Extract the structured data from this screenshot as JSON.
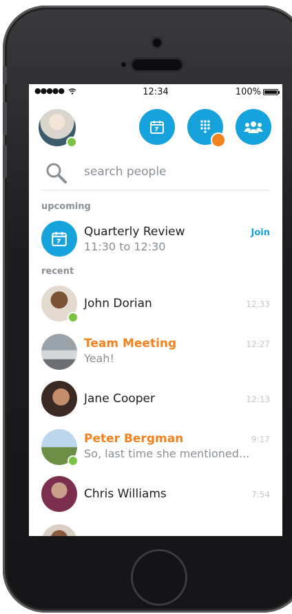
{
  "status_bar": {
    "signal": "●●●●●",
    "time": "12:34",
    "battery": "100%",
    "battery_level": 1.0
  },
  "search": {
    "placeholder": "search people"
  },
  "sections": {
    "upcoming": "upcoming",
    "recent": "recent"
  },
  "upcoming": {
    "title": "Quarterly Review",
    "time_range": "11:30 to 12:30",
    "action": "Join",
    "icon": "calendar-icon"
  },
  "recent": [
    {
      "name": "John Dorian",
      "message": "",
      "time": "12:33",
      "online": true,
      "highlight": false
    },
    {
      "name": "Team Meeting",
      "message": "Yeah!",
      "time": "12:27",
      "online": false,
      "highlight": true
    },
    {
      "name": "Jane Cooper",
      "message": "",
      "time": "12:13",
      "online": false,
      "highlight": false
    },
    {
      "name": "Peter Bergman",
      "message": "So, last time she mentioned...",
      "time": "9:17",
      "online": true,
      "highlight": true
    },
    {
      "name": "Chris Williams",
      "message": "",
      "time": "7:54",
      "online": false,
      "highlight": false
    }
  ],
  "colors": {
    "accent": "#16a3dc",
    "highlight": "#f2821e",
    "online": "#7cc243"
  },
  "action_icons": [
    "calendar-icon",
    "dialpad-icon",
    "contacts-icon"
  ]
}
